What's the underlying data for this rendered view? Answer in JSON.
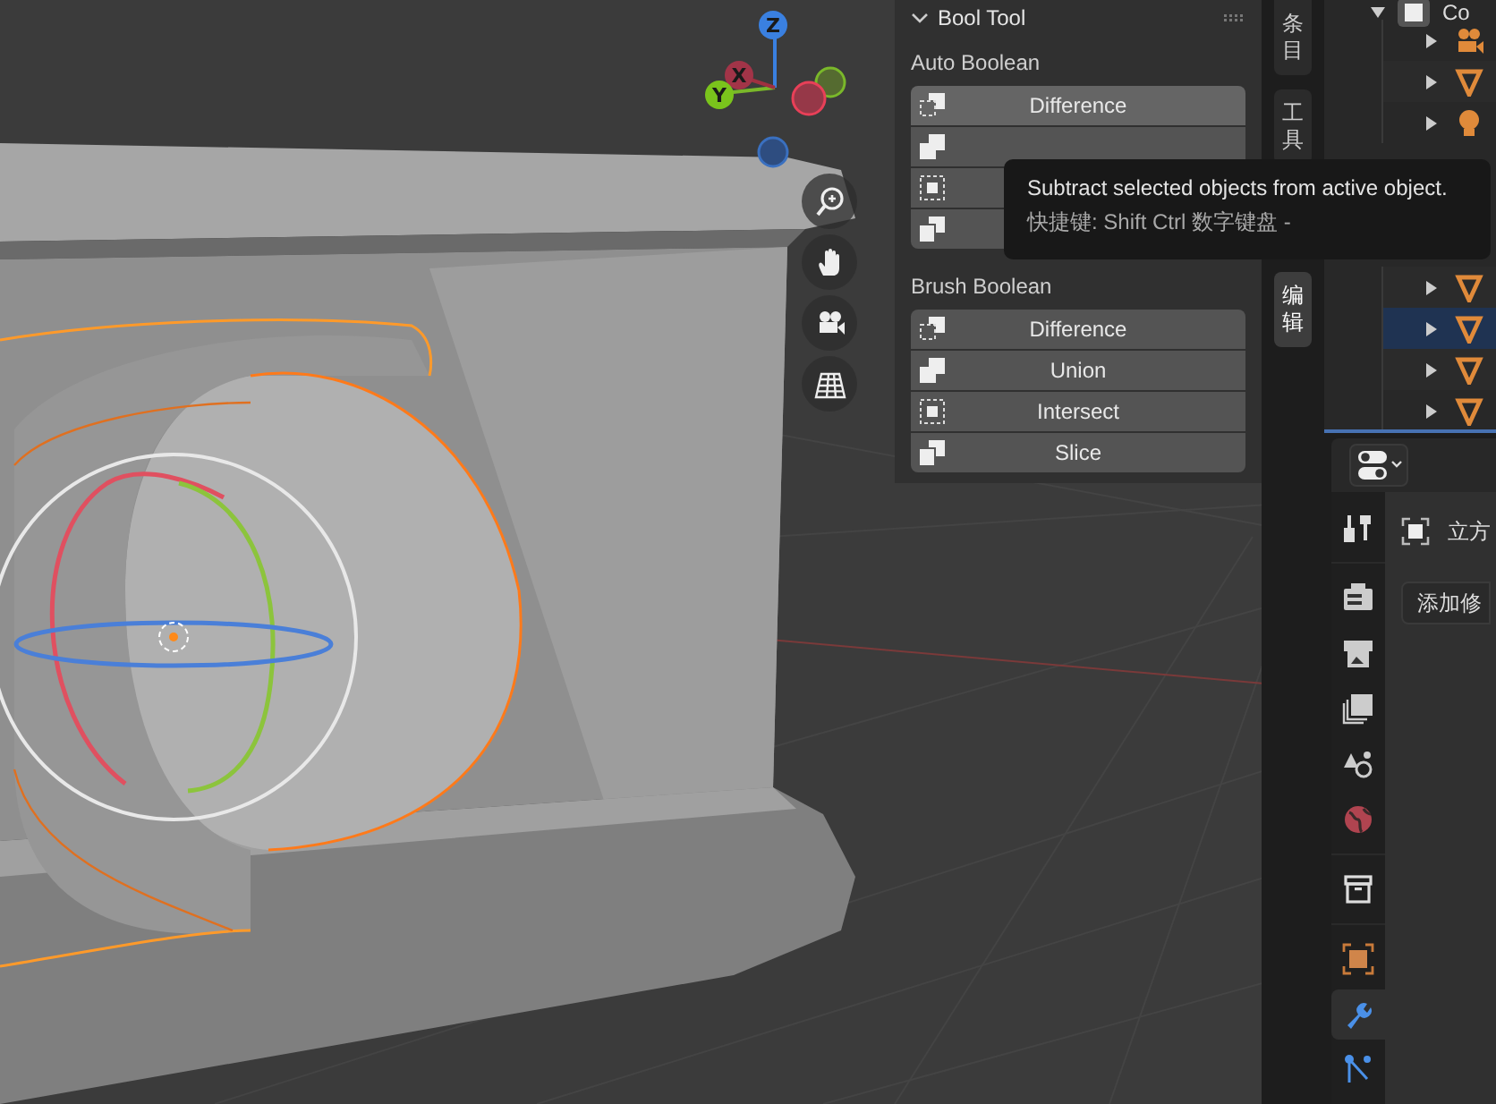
{
  "gizmo": {
    "axes": [
      "Z",
      "X",
      "Y"
    ]
  },
  "view_controls": [
    {
      "kind": "zoom"
    },
    {
      "kind": "pan"
    },
    {
      "kind": "camera"
    },
    {
      "kind": "grid"
    }
  ],
  "bool_tool": {
    "title": "Bool Tool",
    "expanded": true,
    "sections": [
      {
        "heading": "Auto Boolean",
        "buttons": [
          {
            "kind": "difference",
            "label": "Difference",
            "hovered": true
          },
          {
            "kind": "union",
            "hovered": false
          },
          {
            "kind": "intersect",
            "hovered": false
          },
          {
            "kind": "slice",
            "hovered": false
          }
        ]
      },
      {
        "heading": "Brush Boolean",
        "buttons": [
          {
            "kind": "difference",
            "label": "Difference",
            "hovered": false
          },
          {
            "kind": "union",
            "label": "Union",
            "hovered": false
          },
          {
            "kind": "intersect",
            "label": "Intersect",
            "hovered": false
          },
          {
            "kind": "slice",
            "label": "Slice",
            "hovered": false
          }
        ]
      }
    ]
  },
  "sidebar_tabs": [
    {
      "label": "条目",
      "selected": false
    },
    {
      "label": "工具",
      "selected": false
    },
    {
      "label": "编辑",
      "selected": true
    }
  ],
  "tooltip": {
    "description": "Subtract selected objects from active object.",
    "shortcut": "快捷键: Shift Ctrl 数字键盘 -"
  },
  "outliner": {
    "collection": "Co",
    "rows": [
      {
        "kind": "camera",
        "selected": false
      },
      {
        "kind": "mesh",
        "selected": false
      },
      {
        "kind": "light",
        "selected": false
      },
      {
        "kind": "mesh",
        "selected": false
      },
      {
        "kind": "mesh",
        "selected": true
      },
      {
        "kind": "mesh",
        "selected": false
      },
      {
        "kind": "mesh",
        "selected": false
      }
    ]
  },
  "properties": {
    "tabs": [
      {
        "kind": "tool",
        "selected": false
      },
      {
        "kind": "render",
        "selected": false
      },
      {
        "kind": "output",
        "selected": false
      },
      {
        "kind": "view_layer",
        "selected": false
      },
      {
        "kind": "scene",
        "selected": false
      },
      {
        "kind": "world",
        "selected": false
      },
      {
        "kind": "collection",
        "selected": false
      },
      {
        "kind": "object",
        "selected": false
      },
      {
        "kind": "modifier",
        "selected": true
      },
      {
        "kind": "particles",
        "selected": false
      }
    ],
    "object_name": "立方",
    "add_modifier": "添加修"
  }
}
